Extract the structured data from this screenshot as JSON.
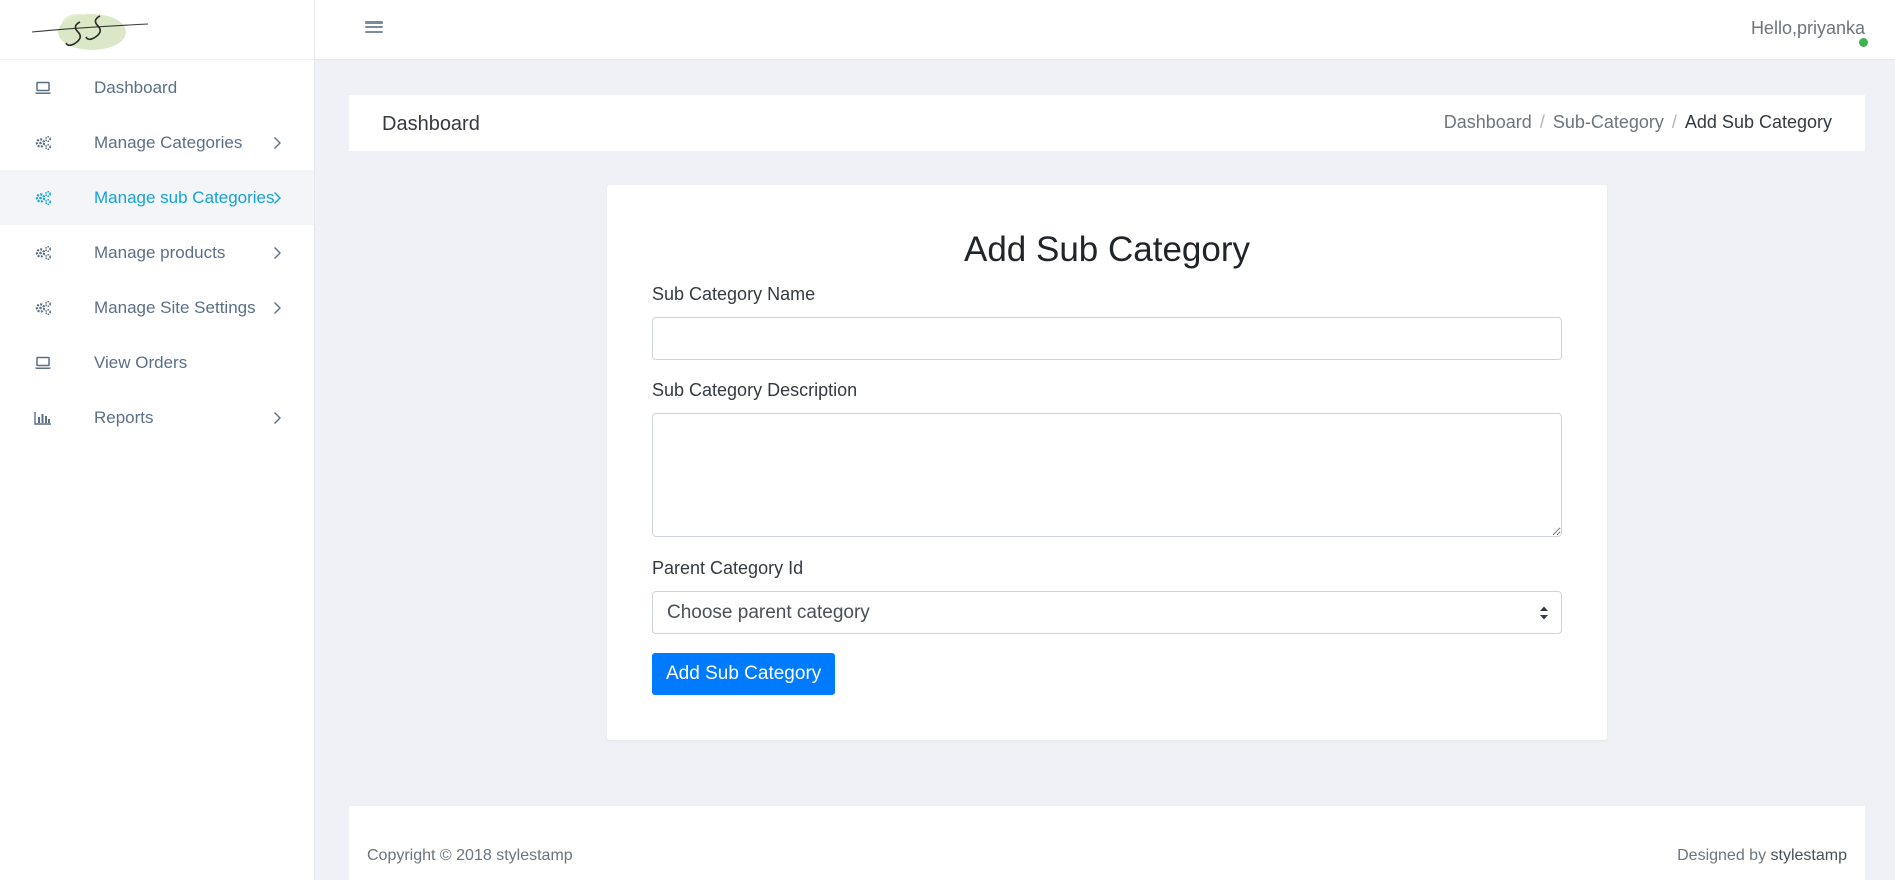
{
  "header": {
    "greeting": "Hello,priyanka",
    "status_color": "#3fb24f"
  },
  "sidebar": {
    "accent_color": "#14a3d8",
    "items": [
      {
        "label": "Dashboard",
        "icon": "laptop-icon",
        "has_children": false,
        "active": false
      },
      {
        "label": "Manage Categories",
        "icon": "gears-icon",
        "has_children": true,
        "active": false
      },
      {
        "label": "Manage sub Categories",
        "icon": "gears-icon",
        "has_children": true,
        "active": true
      },
      {
        "label": "Manage products",
        "icon": "gears-icon",
        "has_children": true,
        "active": false
      },
      {
        "label": "Manage Site Settings",
        "icon": "gears-icon",
        "has_children": true,
        "active": false
      },
      {
        "label": "View Orders",
        "icon": "laptop-icon",
        "has_children": false,
        "active": false
      },
      {
        "label": "Reports",
        "icon": "bar-chart-icon",
        "has_children": true,
        "active": false
      }
    ]
  },
  "page_header": {
    "title": "Dashboard",
    "breadcrumb": [
      "Dashboard",
      "Sub-Category",
      "Add Sub Category"
    ]
  },
  "form": {
    "title": "Add Sub Category",
    "name_label": "Sub Category Name",
    "name_value": "",
    "description_label": "Sub Category Description",
    "description_value": "",
    "parent_label": "Parent Category Id",
    "parent_selected": "Choose parent category",
    "submit_label": "Add Sub Category",
    "submit_color": "#007bff"
  },
  "footer": {
    "copyright": "Copyright © 2018 stylestamp",
    "designed_by_prefix": "Designed by",
    "designed_by_brand": "stylestamp"
  }
}
